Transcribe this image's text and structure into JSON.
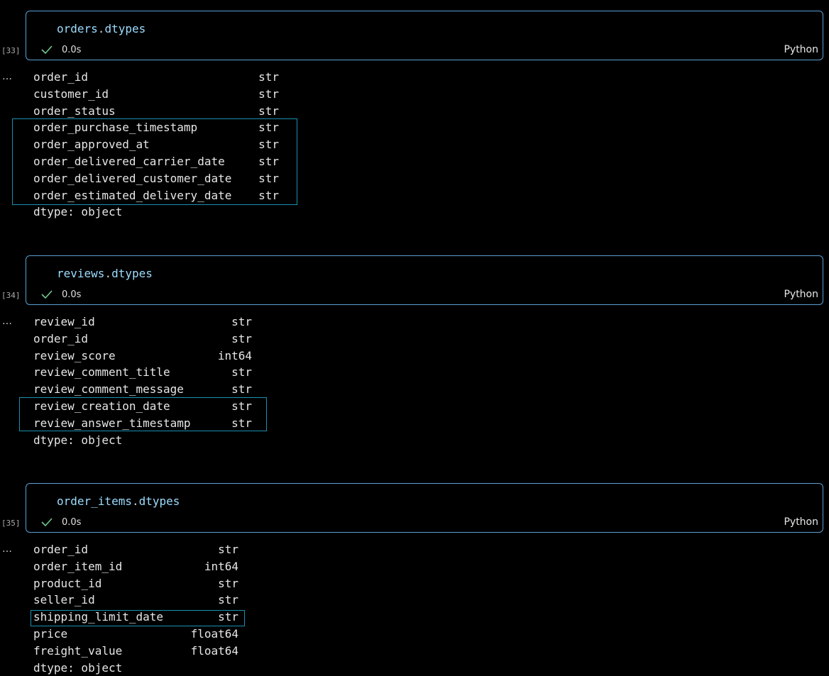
{
  "cells": [
    {
      "exec_count": "[33]",
      "code": {
        "var": "orders",
        "dot": ".",
        "attr": "dtypes"
      },
      "status_time": "0.0s",
      "language": "Python",
      "more_icon": "…",
      "rows": [
        {
          "name": "order_id",
          "type": "str"
        },
        {
          "name": "customer_id",
          "type": "str"
        },
        {
          "name": "order_status",
          "type": "str"
        },
        {
          "name": "order_purchase_timestamp",
          "type": "str"
        },
        {
          "name": "order_approved_at",
          "type": "str"
        },
        {
          "name": "order_delivered_carrier_date",
          "type": "str"
        },
        {
          "name": "order_delivered_customer_date",
          "type": "str"
        },
        {
          "name": "order_estimated_delivery_date",
          "type": "str"
        }
      ],
      "footer": "dtype: object"
    },
    {
      "exec_count": "[34]",
      "code": {
        "var": "reviews",
        "dot": ".",
        "attr": "dtypes"
      },
      "status_time": "0.0s",
      "language": "Python",
      "more_icon": "…",
      "rows": [
        {
          "name": "review_id",
          "type": "str"
        },
        {
          "name": "order_id",
          "type": "str"
        },
        {
          "name": "review_score",
          "type": "int64"
        },
        {
          "name": "review_comment_title",
          "type": "str"
        },
        {
          "name": "review_comment_message",
          "type": "str"
        },
        {
          "name": "review_creation_date",
          "type": "str"
        },
        {
          "name": "review_answer_timestamp",
          "type": "str"
        }
      ],
      "footer": "dtype: object"
    },
    {
      "exec_count": "[35]",
      "code": {
        "var": "order_items",
        "dot": ".",
        "attr": "dtypes"
      },
      "status_time": "0.0s",
      "language": "Python",
      "more_icon": "…",
      "rows": [
        {
          "name": "order_id",
          "type": "str"
        },
        {
          "name": "order_item_id",
          "type": "int64"
        },
        {
          "name": "product_id",
          "type": "str"
        },
        {
          "name": "seller_id",
          "type": "str"
        },
        {
          "name": "shipping_limit_date",
          "type": "str"
        },
        {
          "name": "price",
          "type": "float64"
        },
        {
          "name": "freight_value",
          "type": "float64"
        }
      ],
      "footer": "dtype: object"
    }
  ],
  "icons": {
    "check": "check-icon",
    "more": "more-icon"
  },
  "colors": {
    "cell_border": "#5a9fd2",
    "highlight_box": "#1a8fb0",
    "check": "#73c991",
    "code_identifier": "#9cdcfe",
    "background": "#000000"
  }
}
